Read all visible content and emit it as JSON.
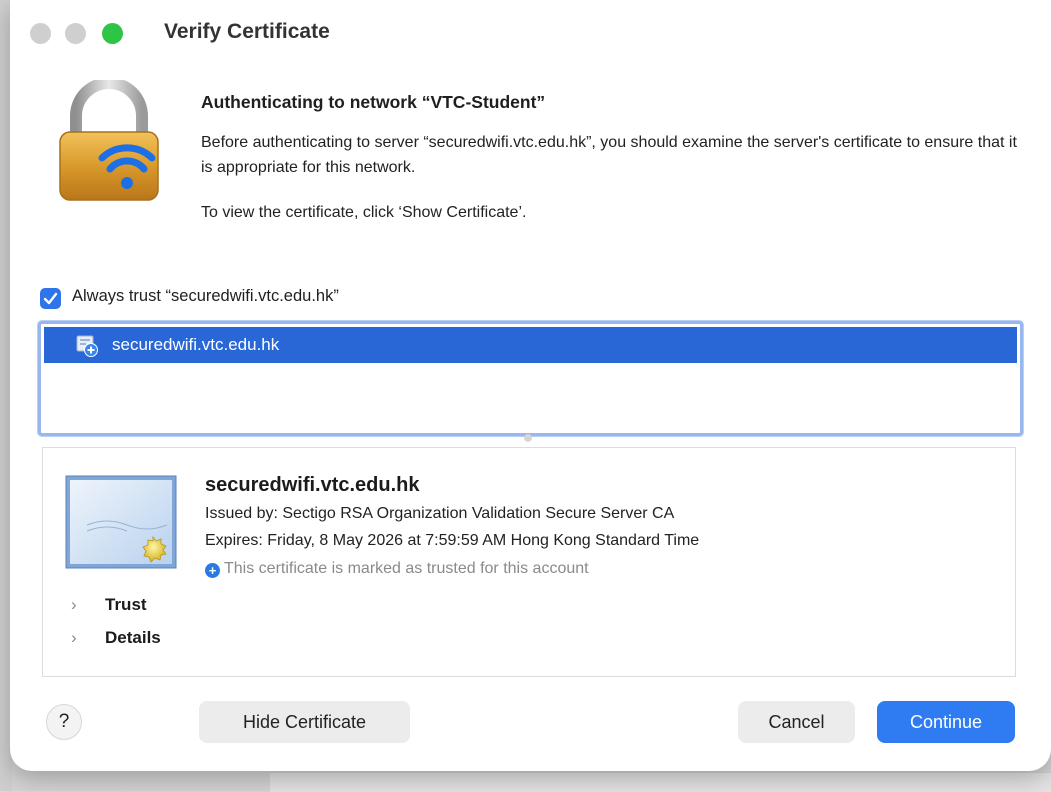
{
  "window": {
    "title": "Verify Certificate"
  },
  "message": {
    "heading": "Authenticating to network “VTC-Student”",
    "description": "Before authenticating to server “securedwifi.vtc.edu.hk”, you should examine the server's certificate to ensure that it is appropriate for this network.",
    "instruction": "To view the certificate, click ‘Show Certificate’."
  },
  "trust_checkbox": {
    "label": "Always trust “securedwifi.vtc.edu.hk”",
    "checked": true
  },
  "certificate_list": {
    "items": [
      {
        "label": "securedwifi.vtc.edu.hk",
        "selected": true
      }
    ]
  },
  "certificate_detail": {
    "name": "securedwifi.vtc.edu.hk",
    "issued_by": "Issued by: Sectigo RSA Organization Validation Secure Server CA",
    "expires": "Expires: Friday, 8 May 2026 at 7:59:59 AM Hong Kong Standard Time",
    "trusted_note": "This certificate is marked as trusted for this account",
    "sections": [
      "Trust",
      "Details"
    ]
  },
  "buttons": {
    "help": "?",
    "hide_certificate": "Hide Certificate",
    "cancel": "Cancel",
    "continue": "Continue"
  },
  "colors": {
    "accent": "#2f7cf2",
    "selection": "#2a67d6",
    "maximize": "#2ec445"
  }
}
